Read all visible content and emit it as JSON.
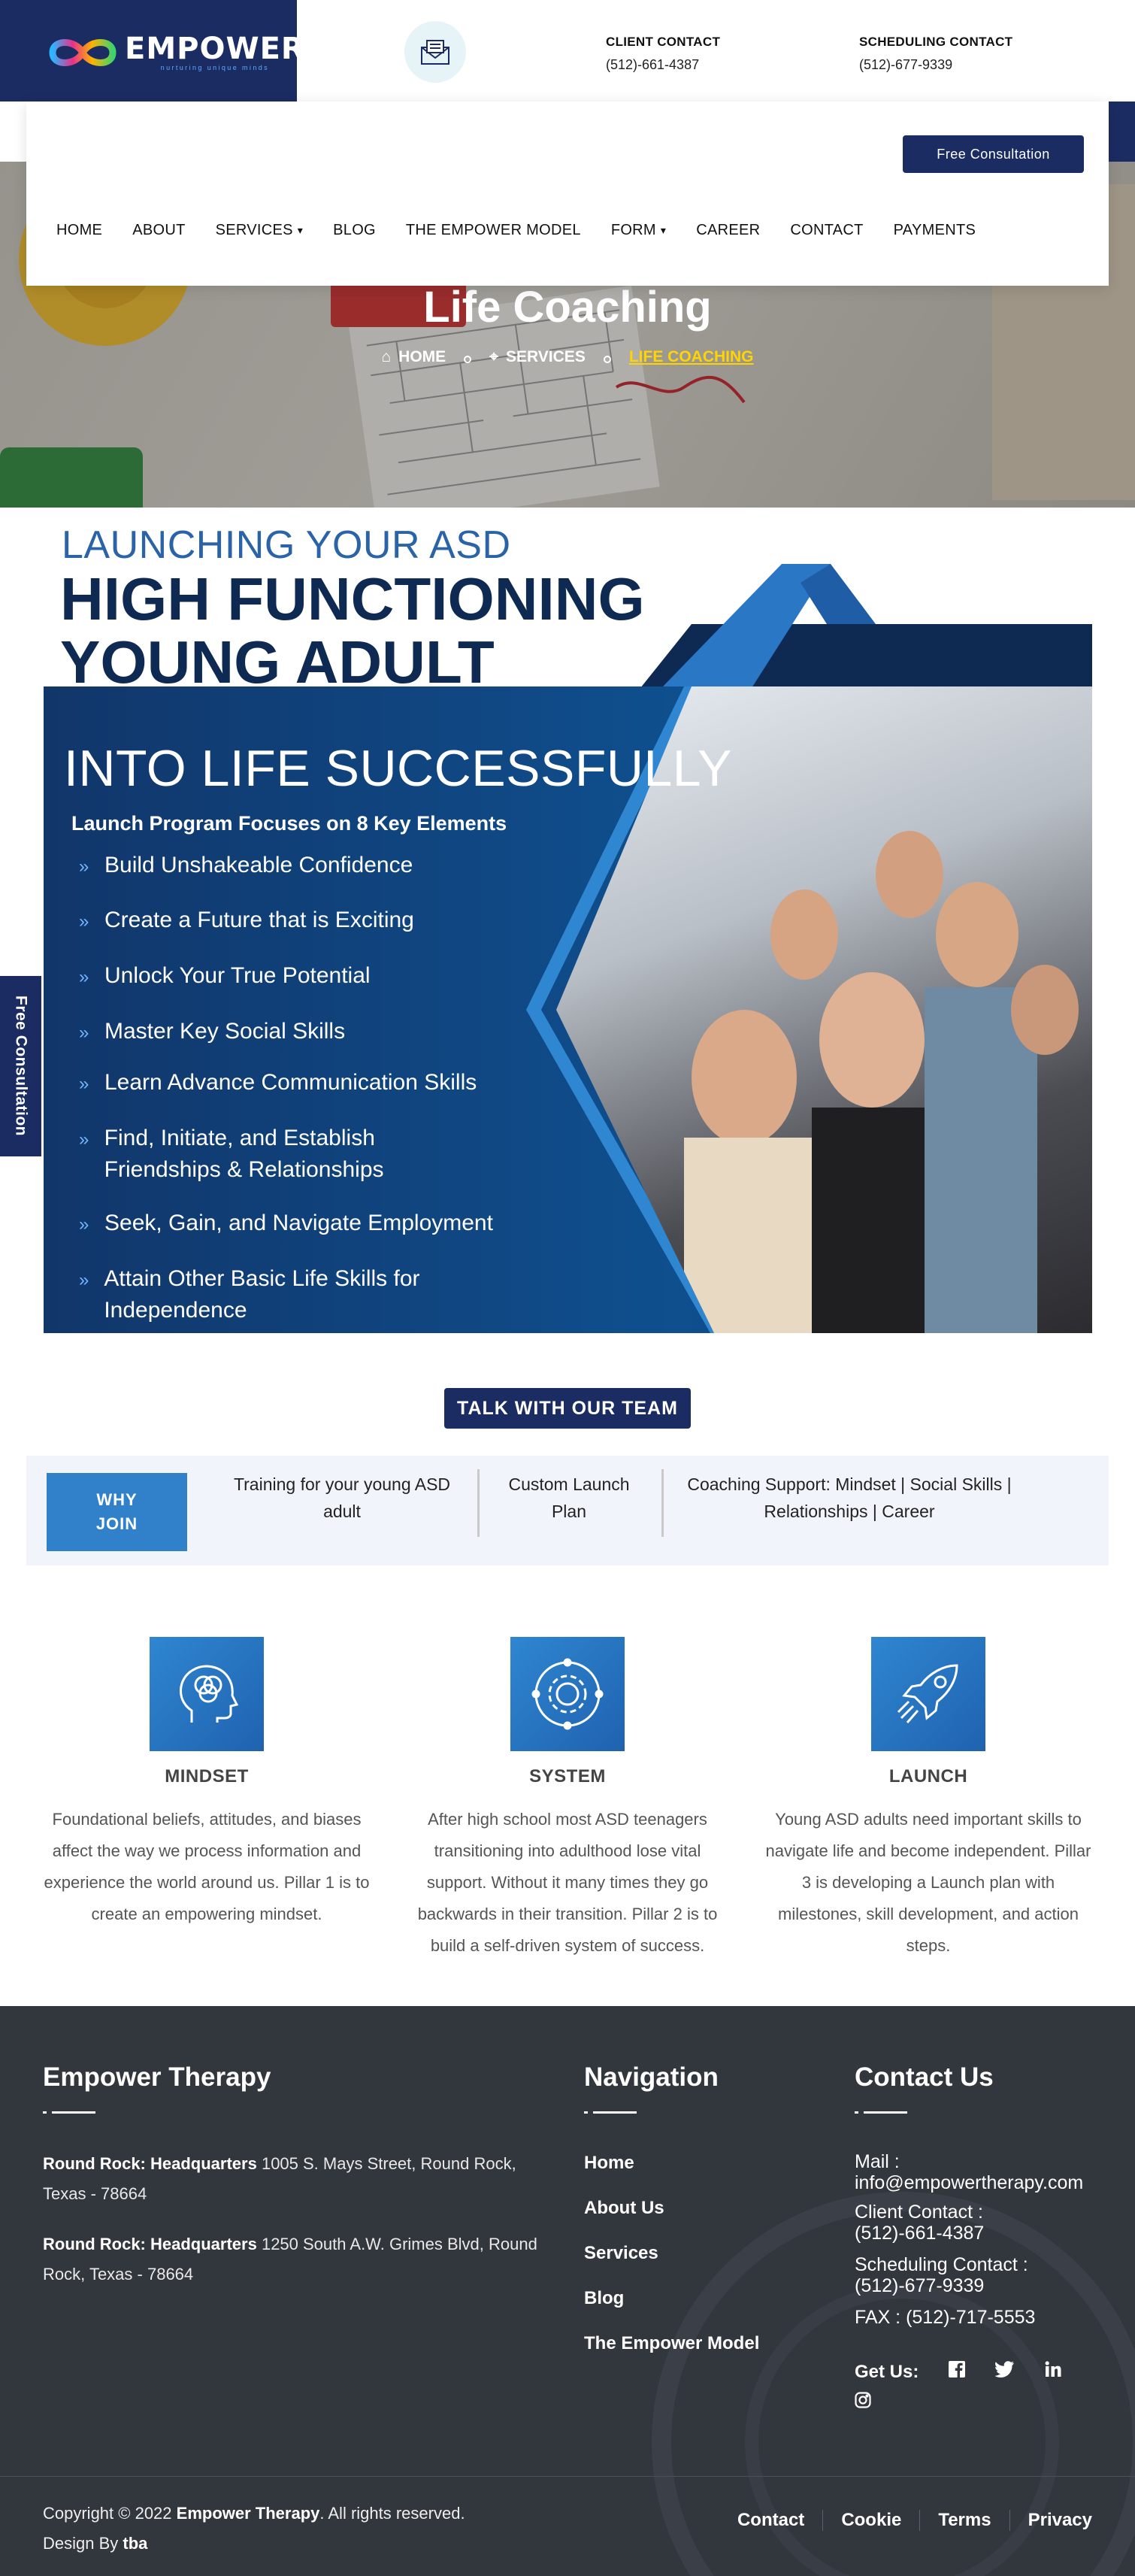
{
  "brand": {
    "name": "EMPOWER",
    "tagline": "nurturing unique minds"
  },
  "contact_bar": {
    "client_label": "CLIENT CONTACT",
    "client_phone": "(512)-661-4387",
    "scheduling_label": "SCHEDULING CONTACT",
    "scheduling_phone": "(512)-677-9339"
  },
  "header": {
    "consult_button": "Free Consultation",
    "nav": [
      {
        "label": "HOME"
      },
      {
        "label": "ABOUT"
      },
      {
        "label": "SERVICES",
        "dropdown": true
      },
      {
        "label": "BLOG"
      },
      {
        "label": "THE EMPOWER MODEL"
      },
      {
        "label": "FORM",
        "dropdown": true
      },
      {
        "label": "CAREER"
      },
      {
        "label": "CONTACT"
      },
      {
        "label": "PAYMENTS"
      }
    ]
  },
  "hero": {
    "title": "Life Coaching",
    "breadcrumb": [
      "HOME",
      "SERVICES",
      "LIFE COACHING"
    ]
  },
  "launch": {
    "subtitle": "LAUNCHING YOUR ASD",
    "headline_line1": "HIGH FUNCTIONING",
    "headline_line2": "YOUNG ADULT",
    "into_life": "INTO LIFE SUCCESSFULLY",
    "program": "Launch Program Focuses on 8 Key Elements",
    "items": [
      "Build Unshakeable Confidence",
      "Create a Future that is Exciting",
      "Unlock Your True Potential",
      "Master Key Social Skills",
      "Learn Advance Communication Skills",
      "Find, Initiate, and Establish Friendships & Relationships",
      "Seek, Gain, and Navigate Employment",
      "Attain Other Basic Life Skills for Independence"
    ]
  },
  "floating_tab": "Free Consultation",
  "talk_button": "TALK WITH OUR TEAM",
  "why_join": {
    "label": "WHY JOIN",
    "items": [
      "Training for your young ASD adult",
      "Custom Launch Plan",
      "Coaching Support: Mindset | Social Skills | Relationships | Career"
    ]
  },
  "pillars": [
    {
      "icon": "head-circles-icon",
      "title": "MINDSET",
      "text": "Foundational beliefs, attitudes, and biases affect the way we process information and experience the world around us. Pillar 1 is to create an empowering mindset."
    },
    {
      "icon": "gear-cycle-icon",
      "title": "SYSTEM",
      "text": "After high school most ASD teenagers transitioning into adulthood lose vital support. Without it many times they go backwards in their transition. Pillar 2 is to build a self-driven system of success."
    },
    {
      "icon": "rocket-icon",
      "title": "LAUNCH",
      "text": "Young ASD adults need important skills to navigate life and become independent. Pillar 3 is developing a Launch plan with milestones, skill development, and action steps."
    }
  ],
  "footer": {
    "company_title": "Empower Therapy",
    "addresses": [
      {
        "label": "Round Rock: Headquarters",
        "text": "1005 S. Mays Street, Round Rock, Texas - 78664"
      },
      {
        "label": "Round Rock: Headquarters",
        "text": "1250 South A.W. Grimes Blvd, Round Rock, Texas - 78664"
      }
    ],
    "nav_title": "Navigation",
    "nav_links": [
      "Home",
      "About Us",
      "Services",
      "Blog",
      "The Empower Model"
    ],
    "contact_title": "Contact Us",
    "mail_label": "Mail :",
    "mail": "info@empowertherapy.com",
    "client_label": "Client Contact :",
    "client_phone": "(512)-661-4387",
    "scheduling_label": "Scheduling Contact :",
    "scheduling_phone": "(512)-677-9339",
    "fax": "FAX : (512)-717-5553",
    "get_us": "Get Us:",
    "copyright_prefix": "Copyright © 2022 ",
    "copyright_brand": "Empower Therapy",
    "copyright_suffix": ". All rights reserved.",
    "design_by_prefix": "Design By ",
    "design_by": "tba",
    "bottom_links": [
      "Contact",
      "Cookie",
      "Terms",
      "Privacy"
    ]
  },
  "colors": {
    "navy": "#1b2c63",
    "accent_blue": "#3081c9",
    "breadcrumb_active": "#ffd400",
    "footer_bg": "#32363d"
  }
}
